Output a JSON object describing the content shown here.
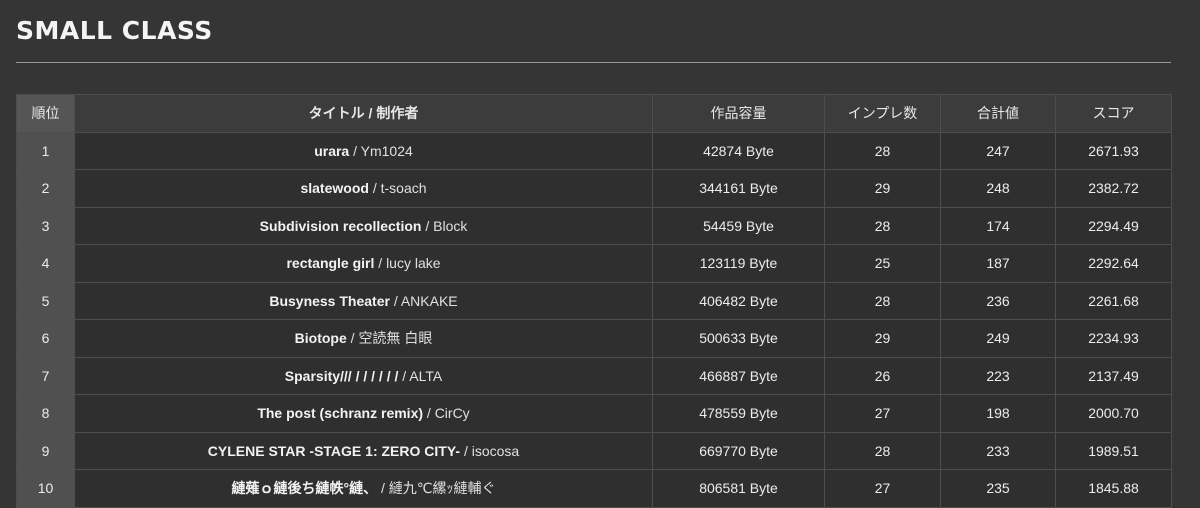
{
  "section": {
    "title": "SMALL CLASS"
  },
  "table": {
    "headers": {
      "rank": "順位",
      "title": "タイトル / 制作者",
      "size": "作品容量",
      "votes": "インプレ数",
      "total": "合計値",
      "score": "スコア"
    },
    "rows": [
      {
        "rank": "1",
        "title": "urara",
        "sep": " / ",
        "creator": "Ym1024",
        "size": "42874 Byte",
        "votes": "28",
        "total": "247",
        "score": "2671.93"
      },
      {
        "rank": "2",
        "title": "slatewood",
        "sep": " / ",
        "creator": "t-soach",
        "size": "344161 Byte",
        "votes": "29",
        "total": "248",
        "score": "2382.72"
      },
      {
        "rank": "3",
        "title": "Subdivision recollection",
        "sep": " / ",
        "creator": "Block",
        "size": "54459 Byte",
        "votes": "28",
        "total": "174",
        "score": "2294.49"
      },
      {
        "rank": "4",
        "title": "rectangle girl",
        "sep": " / ",
        "creator": "lucy lake",
        "size": "123119 Byte",
        "votes": "25",
        "total": "187",
        "score": "2292.64"
      },
      {
        "rank": "5",
        "title": "Busyness Theater",
        "sep": " / ",
        "creator": "ANKAKE",
        "size": "406482 Byte",
        "votes": "28",
        "total": "236",
        "score": "2261.68"
      },
      {
        "rank": "6",
        "title": "Biotope",
        "sep": " / ",
        "creator": "空読無 白眼",
        "size": "500633 Byte",
        "votes": "29",
        "total": "249",
        "score": "2234.93"
      },
      {
        "rank": "7",
        "title": "Sparsity/// / / / / / /",
        "sep": " / ",
        "creator": "ALTA",
        "size": "466887 Byte",
        "votes": "26",
        "total": "223",
        "score": "2137.49"
      },
      {
        "rank": "8",
        "title": "The post (schranz remix)",
        "sep": " / ",
        "creator": "CirCy",
        "size": "478559 Byte",
        "votes": "27",
        "total": "198",
        "score": "2000.70"
      },
      {
        "rank": "9",
        "title": "CYLENE STAR -STAGE 1: ZERO CITY-",
        "sep": " / ",
        "creator": "isocosa",
        "size": "669770 Byte",
        "votes": "28",
        "total": "233",
        "score": "1989.51"
      },
      {
        "rank": "10",
        "title": "縺薙ｏ縺後ち縺帙°縺、",
        "sep": " / ",
        "creator": "縺九℃縲ｯ縺輔ぐ",
        "size": "806581 Byte",
        "votes": "27",
        "total": "235",
        "score": "1845.88"
      }
    ]
  }
}
